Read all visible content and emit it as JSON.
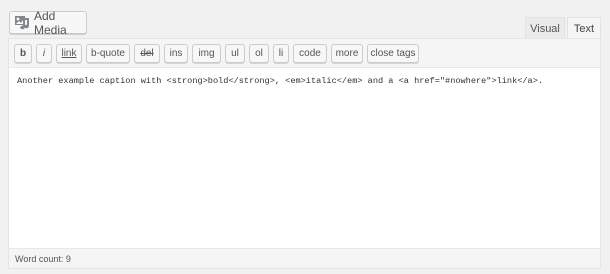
{
  "toolbar_top": {
    "add_media_label": "Add Media"
  },
  "tabs": {
    "visual": "Visual",
    "text": "Text"
  },
  "quicktags": [
    "b",
    "i",
    "link",
    "b-quote",
    "del",
    "ins",
    "img",
    "ul",
    "ol",
    "li",
    "code",
    "more",
    "close tags"
  ],
  "editor": {
    "content": "Another example caption with <strong>bold</strong>, <em>italic</em> and a <a href=\"#nowhere\">link</a>."
  },
  "status": {
    "word_count": "Word count: 9"
  }
}
